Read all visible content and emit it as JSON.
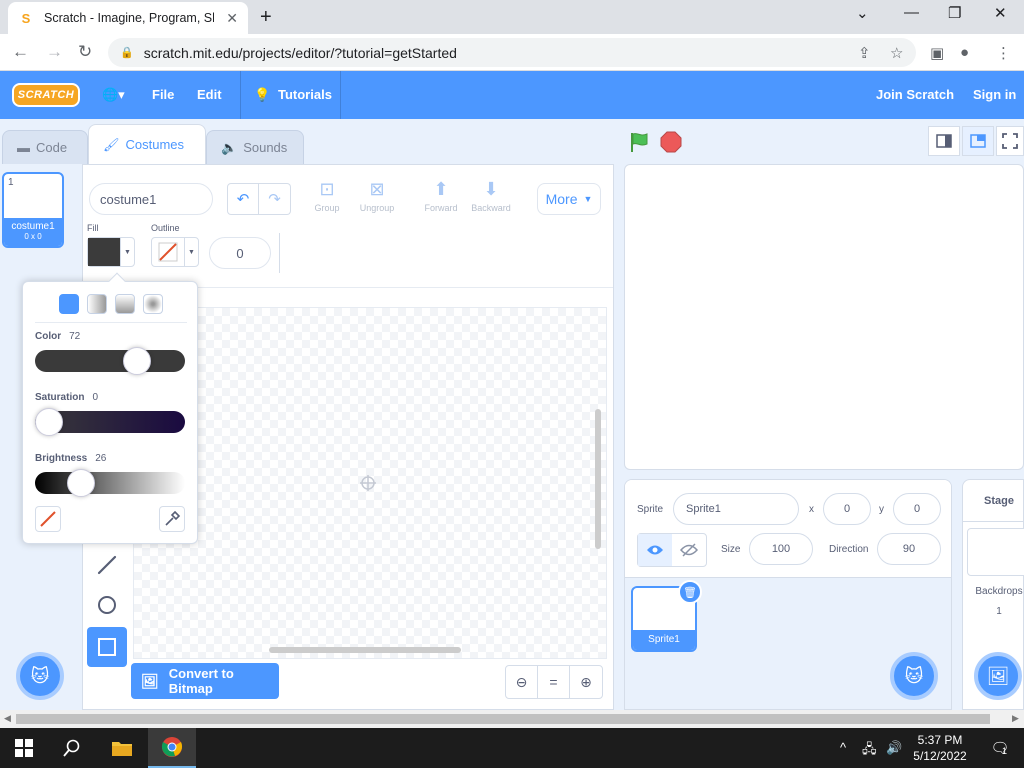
{
  "browser": {
    "tab_title": "Scratch - Imagine, Program, Shar",
    "url": "scratch.mit.edu/projects/editor/?tutorial=getStarted"
  },
  "menubar": {
    "logo_text": "SCRATCH",
    "file": "File",
    "edit": "Edit",
    "tutorials": "Tutorials",
    "join": "Join Scratch",
    "signin": "Sign in"
  },
  "editor_tabs": {
    "code": "Code",
    "costumes": "Costumes",
    "sounds": "Sounds"
  },
  "costume": {
    "number": "1",
    "name": "costume1",
    "size": "0 x 0"
  },
  "paint": {
    "costume_name": "costume1",
    "group": "Group",
    "ungroup": "Ungroup",
    "forward": "Forward",
    "backward": "Backward",
    "more": "More",
    "fill_label": "Fill",
    "outline_label": "Outline",
    "outline_width": "0",
    "fill_color": "#3b3b3b",
    "convert": "Convert to Bitmap"
  },
  "color_picker": {
    "color_label": "Color",
    "color_value": "72",
    "saturation_label": "Saturation",
    "saturation_value": "0",
    "brightness_label": "Brightness",
    "brightness_value": "26",
    "color_level": 0.72,
    "saturation_level": 0,
    "brightness_level": 0.26
  },
  "sprite_info": {
    "sprite_label": "Sprite",
    "sprite_name": "Sprite1",
    "x_label": "x",
    "x_value": "0",
    "y_label": "y",
    "y_value": "0",
    "size_label": "Size",
    "size_value": "100",
    "direction_label": "Direction",
    "direction_value": "90"
  },
  "sprites": [
    {
      "name": "Sprite1"
    }
  ],
  "stage_pane": {
    "title": "Stage",
    "backdrops_label": "Backdrops",
    "backdrops_count": "1"
  },
  "taskbar": {
    "time": "5:37 PM",
    "date": "5/12/2022",
    "notifications": "1"
  },
  "colors": {
    "scratch_blue": "#4c97ff",
    "brand_orange": "#f6a623",
    "flag_green": "#4cbf56",
    "stop_red": "#ec5959"
  }
}
